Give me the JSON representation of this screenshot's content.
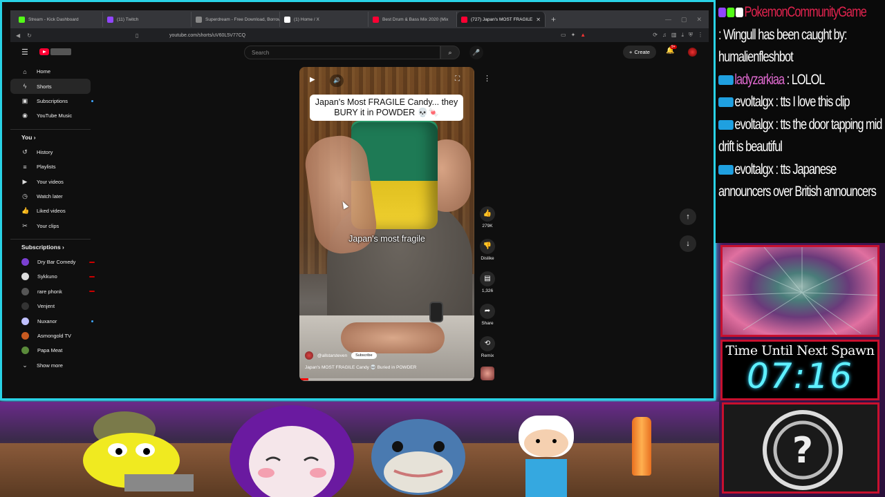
{
  "tabs": [
    {
      "label": "Stream - Kick Dashboard",
      "color": "#53fc18"
    },
    {
      "label": "(11) Twitch",
      "color": "#9146ff"
    },
    {
      "label": "Superdream - Free Download, Borrow",
      "color": "#888888"
    },
    {
      "label": "(1) Home / X",
      "color": "#ffffff"
    },
    {
      "label": "Best Drum & Bass Mix 2020 (Mix",
      "color": "#ff0033"
    },
    {
      "label": "(727) Japan's MOST FRAGILE",
      "color": "#ff0033",
      "active": true
    }
  ],
  "address": {
    "url": "youtube.com/shorts/uV60L5V77CQ"
  },
  "search": {
    "placeholder": "Search"
  },
  "header": {
    "create_label": "Create",
    "notif_count": "9+"
  },
  "sidebar": {
    "main": [
      {
        "label": "Home",
        "icon": "home-icon"
      },
      {
        "label": "Shorts",
        "icon": "shorts-icon",
        "active": true
      },
      {
        "label": "Subscriptions",
        "icon": "subscriptions-icon"
      },
      {
        "label": "YouTube Music",
        "icon": "music-icon"
      }
    ],
    "you_label": "You",
    "you": [
      {
        "label": "History",
        "icon": "history-icon"
      },
      {
        "label": "Playlists",
        "icon": "playlists-icon"
      },
      {
        "label": "Your videos",
        "icon": "your-videos-icon"
      },
      {
        "label": "Watch later",
        "icon": "watch-later-icon"
      },
      {
        "label": "Liked videos",
        "icon": "liked-videos-icon"
      },
      {
        "label": "Your clips",
        "icon": "clips-icon"
      }
    ],
    "subs_label": "Subscriptions",
    "subs": [
      {
        "label": "Dry Bar Comedy",
        "color": "#7a3fd1"
      },
      {
        "label": "Sykkuno",
        "color": "#dddddd"
      },
      {
        "label": "rare phonk",
        "color": "#555555"
      },
      {
        "label": "Venjent",
        "color": "#333333"
      },
      {
        "label": "Nuxanor",
        "color": "#c0c0ff"
      },
      {
        "label": "Asmongold TV",
        "color": "#c85a20"
      },
      {
        "label": "Papa Meat",
        "color": "#5a8a3a"
      }
    ],
    "show_more": "Show more"
  },
  "short": {
    "caption_top": "Japan's Most FRAGILE Candy... they BURY it in POWDER 💀🍬",
    "caption_mid": "Japan's most fragile",
    "channel": "@allstarsteven",
    "subscribe": "Subscribe",
    "title": "Japan's MOST FRAGILE Candy 💀 Buried in POWDER",
    "progress": 0.05
  },
  "actions": {
    "likes": "279K",
    "dislike": "Dislike",
    "comments": "1,326",
    "share": "Share",
    "remix": "Remix"
  },
  "chat": {
    "channel": "PokemonCommunityGame",
    "messages": [
      {
        "text": ": Wingull has been caught by: humalienfleshbot",
        "color": "#ffffff"
      },
      {
        "user": "ladyzarkiaa",
        "text": " : LOLOL",
        "color": "#e06ad0"
      },
      {
        "user": "evoltalgx",
        "text": " : tts I love this clip",
        "color": "#ffffff"
      },
      {
        "user": "evoltalgx",
        "text": " : tts the door tapping mid drift is beautiful",
        "color": "#ffffff"
      },
      {
        "user": "evoltalgx",
        "text": " : tts Japanese announcers over British announcers",
        "color": "#ffffff"
      }
    ]
  },
  "spawn": {
    "label": "Time Until Next Spawn",
    "time": "07:16"
  },
  "colors": {
    "frame": "#29d3e6",
    "youtube_red": "#ff0033",
    "spawn_border": "#c8102e",
    "timer": "#5ef0ff"
  }
}
